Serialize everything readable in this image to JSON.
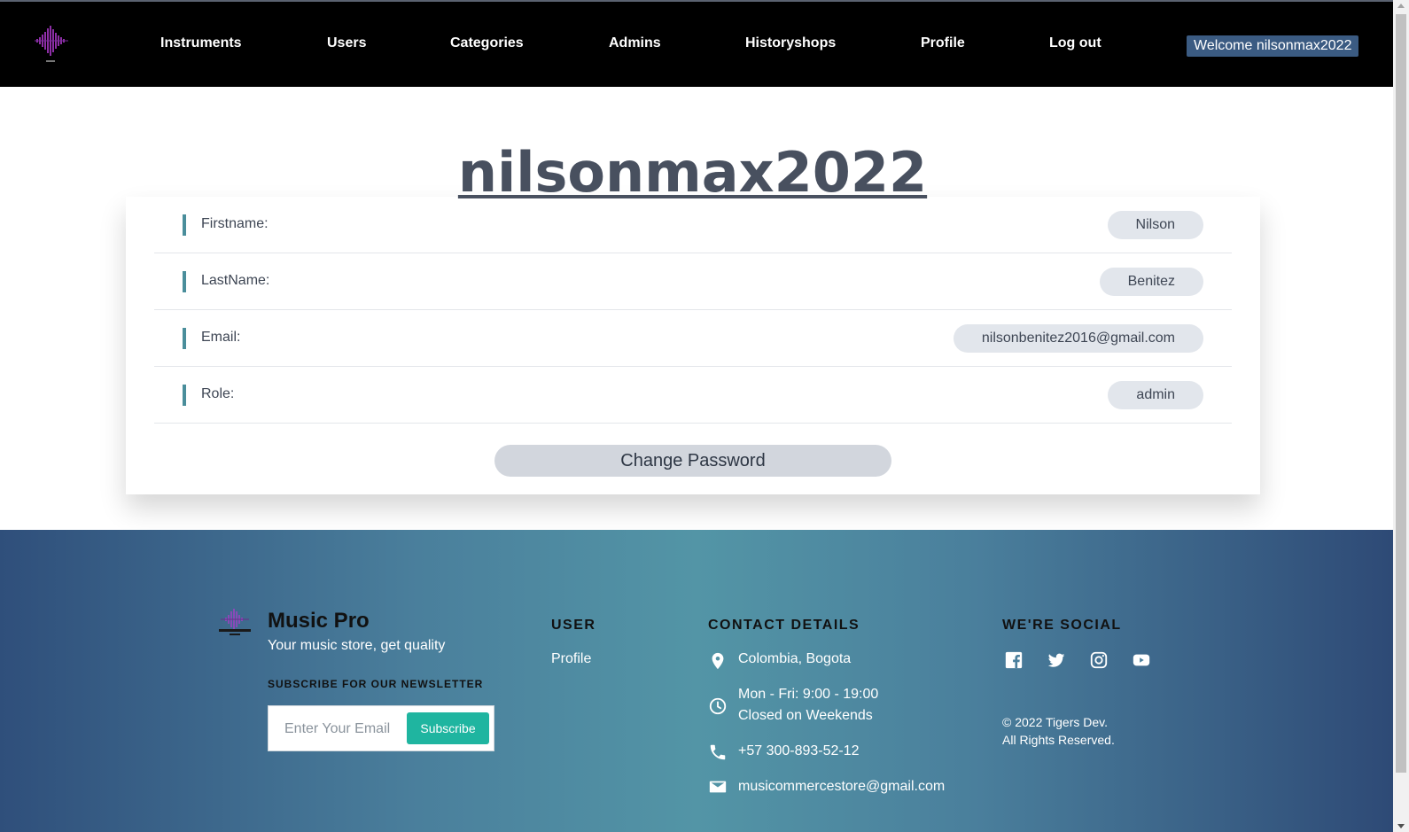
{
  "navbar": {
    "logo_icon": "music-waveform-logo",
    "links": [
      {
        "label": "Instruments"
      },
      {
        "label": "Users"
      },
      {
        "label": "Categories"
      },
      {
        "label": "Admins"
      },
      {
        "label": "Historyshops"
      },
      {
        "label": "Profile"
      },
      {
        "label": "Log out"
      }
    ],
    "welcome": "Welcome nilsonmax2022"
  },
  "profile": {
    "username": "nilsonmax2022",
    "fields": [
      {
        "label": "Firstname:",
        "value": "Nilson"
      },
      {
        "label": "LastName:",
        "value": "Benitez"
      },
      {
        "label": "Email:",
        "value": "nilsonbenitez2016@gmail.com"
      },
      {
        "label": "Role:",
        "value": "admin"
      }
    ],
    "change_password_label": "Change Password"
  },
  "footer": {
    "brand": "Music Pro",
    "tagline": "Your music store, get quality",
    "newsletter_title": "SUBSCRIBE FOR OUR NEWSLETTER",
    "newsletter_placeholder": "Enter Your Email",
    "subscribe_label": "Subscribe",
    "user_title": "USER",
    "user_link": "Profile",
    "contact_title": "CONTACT DETAILS",
    "contact": {
      "location": "Colombia, Bogota",
      "hours_line1": "Mon - Fri: 9:00 - 19:00",
      "hours_line2": "Closed on Weekends",
      "phone": "+57 300-893-52-12",
      "email": "musicommercestore@gmail.com"
    },
    "social_title": "WE'RE SOCIAL",
    "social_icons": [
      "facebook-icon",
      "twitter-icon",
      "instagram-icon",
      "youtube-icon"
    ],
    "copyright_line1": "© 2022 Tigers Dev.",
    "copyright_line2": "All Rights Reserved."
  },
  "colors": {
    "navbar_bg": "#000000",
    "welcome_bg": "#3b5b82",
    "accent_bar": "#4a8e9b",
    "subscribe_btn": "#1fb5a0",
    "footer_gradient_start": "#2f4f7b",
    "footer_gradient_mid": "#5395a6"
  }
}
